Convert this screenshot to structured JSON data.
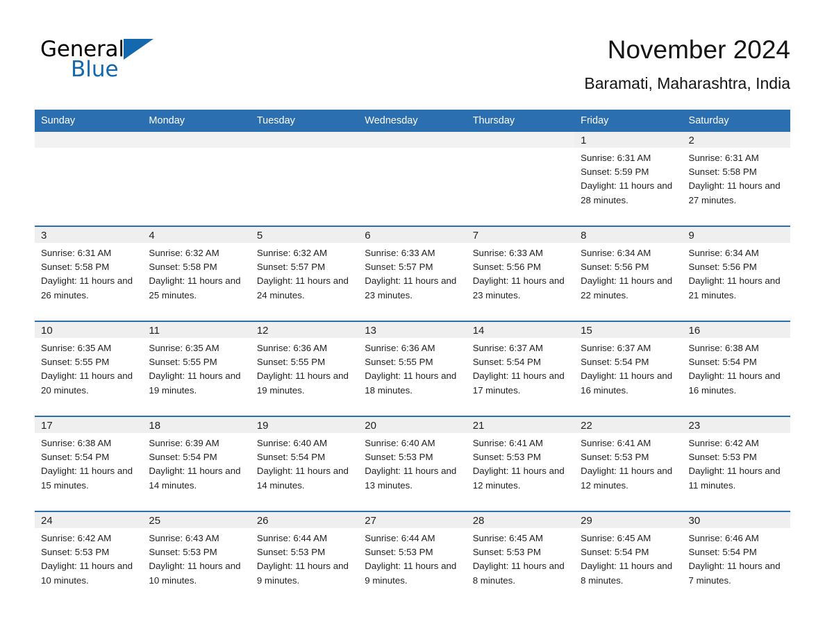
{
  "logo": {
    "word_black": "General",
    "word_blue": "Blue",
    "triangle_color": "#1368ae",
    "icon": "general-blue-logo"
  },
  "header": {
    "title": "November 2024",
    "subtitle": "Baramati, Maharashtra, India"
  },
  "theme": {
    "header_blue": "#2b6fb0",
    "daynum_band": "#efefef",
    "row_divider": "#2b6fb0",
    "text": "#1f1f1f",
    "page_bg": "#ffffff"
  },
  "weekday_headers": [
    "Sunday",
    "Monday",
    "Tuesday",
    "Wednesday",
    "Thursday",
    "Friday",
    "Saturday"
  ],
  "labels": {
    "sunrise_prefix": "Sunrise:",
    "sunset_prefix": "Sunset:",
    "daylight_prefix": "Daylight:"
  },
  "weeks": [
    [
      {
        "day": "",
        "lines": []
      },
      {
        "day": "",
        "lines": []
      },
      {
        "day": "",
        "lines": []
      },
      {
        "day": "",
        "lines": []
      },
      {
        "day": "",
        "lines": []
      },
      {
        "day": "1",
        "lines": [
          "Sunrise: 6:31 AM",
          "Sunset: 5:59 PM",
          "Daylight: 11 hours and 28 minutes."
        ]
      },
      {
        "day": "2",
        "lines": [
          "Sunrise: 6:31 AM",
          "Sunset: 5:58 PM",
          "Daylight: 11 hours and 27 minutes."
        ]
      }
    ],
    [
      {
        "day": "3",
        "lines": [
          "Sunrise: 6:31 AM",
          "Sunset: 5:58 PM",
          "Daylight: 11 hours and 26 minutes."
        ]
      },
      {
        "day": "4",
        "lines": [
          "Sunrise: 6:32 AM",
          "Sunset: 5:58 PM",
          "Daylight: 11 hours and 25 minutes."
        ]
      },
      {
        "day": "5",
        "lines": [
          "Sunrise: 6:32 AM",
          "Sunset: 5:57 PM",
          "Daylight: 11 hours and 24 minutes."
        ]
      },
      {
        "day": "6",
        "lines": [
          "Sunrise: 6:33 AM",
          "Sunset: 5:57 PM",
          "Daylight: 11 hours and 23 minutes."
        ]
      },
      {
        "day": "7",
        "lines": [
          "Sunrise: 6:33 AM",
          "Sunset: 5:56 PM",
          "Daylight: 11 hours and 23 minutes."
        ]
      },
      {
        "day": "8",
        "lines": [
          "Sunrise: 6:34 AM",
          "Sunset: 5:56 PM",
          "Daylight: 11 hours and 22 minutes."
        ]
      },
      {
        "day": "9",
        "lines": [
          "Sunrise: 6:34 AM",
          "Sunset: 5:56 PM",
          "Daylight: 11 hours and 21 minutes."
        ]
      }
    ],
    [
      {
        "day": "10",
        "lines": [
          "Sunrise: 6:35 AM",
          "Sunset: 5:55 PM",
          "Daylight: 11 hours and 20 minutes."
        ]
      },
      {
        "day": "11",
        "lines": [
          "Sunrise: 6:35 AM",
          "Sunset: 5:55 PM",
          "Daylight: 11 hours and 19 minutes."
        ]
      },
      {
        "day": "12",
        "lines": [
          "Sunrise: 6:36 AM",
          "Sunset: 5:55 PM",
          "Daylight: 11 hours and 19 minutes."
        ]
      },
      {
        "day": "13",
        "lines": [
          "Sunrise: 6:36 AM",
          "Sunset: 5:55 PM",
          "Daylight: 11 hours and 18 minutes."
        ]
      },
      {
        "day": "14",
        "lines": [
          "Sunrise: 6:37 AM",
          "Sunset: 5:54 PM",
          "Daylight: 11 hours and 17 minutes."
        ]
      },
      {
        "day": "15",
        "lines": [
          "Sunrise: 6:37 AM",
          "Sunset: 5:54 PM",
          "Daylight: 11 hours and 16 minutes."
        ]
      },
      {
        "day": "16",
        "lines": [
          "Sunrise: 6:38 AM",
          "Sunset: 5:54 PM",
          "Daylight: 11 hours and 16 minutes."
        ]
      }
    ],
    [
      {
        "day": "17",
        "lines": [
          "Sunrise: 6:38 AM",
          "Sunset: 5:54 PM",
          "Daylight: 11 hours and 15 minutes."
        ]
      },
      {
        "day": "18",
        "lines": [
          "Sunrise: 6:39 AM",
          "Sunset: 5:54 PM",
          "Daylight: 11 hours and 14 minutes."
        ]
      },
      {
        "day": "19",
        "lines": [
          "Sunrise: 6:40 AM",
          "Sunset: 5:54 PM",
          "Daylight: 11 hours and 14 minutes."
        ]
      },
      {
        "day": "20",
        "lines": [
          "Sunrise: 6:40 AM",
          "Sunset: 5:53 PM",
          "Daylight: 11 hours and 13 minutes."
        ]
      },
      {
        "day": "21",
        "lines": [
          "Sunrise: 6:41 AM",
          "Sunset: 5:53 PM",
          "Daylight: 11 hours and 12 minutes."
        ]
      },
      {
        "day": "22",
        "lines": [
          "Sunrise: 6:41 AM",
          "Sunset: 5:53 PM",
          "Daylight: 11 hours and 12 minutes."
        ]
      },
      {
        "day": "23",
        "lines": [
          "Sunrise: 6:42 AM",
          "Sunset: 5:53 PM",
          "Daylight: 11 hours and 11 minutes."
        ]
      }
    ],
    [
      {
        "day": "24",
        "lines": [
          "Sunrise: 6:42 AM",
          "Sunset: 5:53 PM",
          "Daylight: 11 hours and 10 minutes."
        ]
      },
      {
        "day": "25",
        "lines": [
          "Sunrise: 6:43 AM",
          "Sunset: 5:53 PM",
          "Daylight: 11 hours and 10 minutes."
        ]
      },
      {
        "day": "26",
        "lines": [
          "Sunrise: 6:44 AM",
          "Sunset: 5:53 PM",
          "Daylight: 11 hours and 9 minutes."
        ]
      },
      {
        "day": "27",
        "lines": [
          "Sunrise: 6:44 AM",
          "Sunset: 5:53 PM",
          "Daylight: 11 hours and 9 minutes."
        ]
      },
      {
        "day": "28",
        "lines": [
          "Sunrise: 6:45 AM",
          "Sunset: 5:53 PM",
          "Daylight: 11 hours and 8 minutes."
        ]
      },
      {
        "day": "29",
        "lines": [
          "Sunrise: 6:45 AM",
          "Sunset: 5:54 PM",
          "Daylight: 11 hours and 8 minutes."
        ]
      },
      {
        "day": "30",
        "lines": [
          "Sunrise: 6:46 AM",
          "Sunset: 5:54 PM",
          "Daylight: 11 hours and 7 minutes."
        ]
      }
    ]
  ]
}
